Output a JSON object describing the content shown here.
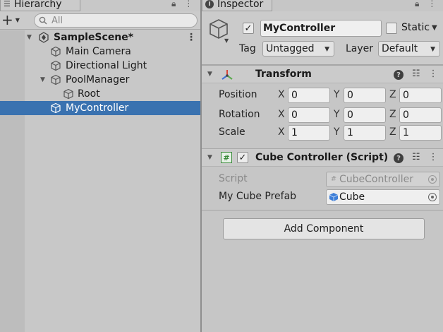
{
  "hierarchy": {
    "tab_label": "Hierarchy",
    "search_placeholder": "All",
    "items": [
      {
        "label": "SampleScene*",
        "type": "scene"
      },
      {
        "label": "Main Camera",
        "type": "object"
      },
      {
        "label": "Directional Light",
        "type": "object"
      },
      {
        "label": "PoolManager",
        "type": "object"
      },
      {
        "label": "Root",
        "type": "object"
      },
      {
        "label": "MyController",
        "type": "object",
        "selected": true
      }
    ]
  },
  "inspector": {
    "tab_label": "Inspector",
    "object_name": "MyController",
    "active_checked": true,
    "static_label": "Static",
    "tag_label": "Tag",
    "tag_value": "Untagged",
    "layer_label": "Layer",
    "layer_value": "Default",
    "transform": {
      "title": "Transform",
      "rows": [
        {
          "label": "Position",
          "x": "0",
          "y": "0",
          "z": "0"
        },
        {
          "label": "Rotation",
          "x": "0",
          "y": "0",
          "z": "0"
        },
        {
          "label": "Scale",
          "x": "1",
          "y": "1",
          "z": "1"
        }
      ],
      "axis_x": "X",
      "axis_y": "Y",
      "axis_z": "Z"
    },
    "script_component": {
      "title": "Cube Controller (Script)",
      "enabled": true,
      "script_label": "Script",
      "script_value": "CubeController",
      "prefab_label": "My Cube Prefab",
      "prefab_value": "Cube"
    },
    "add_component_label": "Add Component"
  },
  "colors": {
    "selection": "#3a72b0",
    "transform_red": "#d9463b",
    "transform_green": "#5aa94d",
    "transform_blue": "#3d6fd6",
    "script_green": "#3a8a3a"
  }
}
